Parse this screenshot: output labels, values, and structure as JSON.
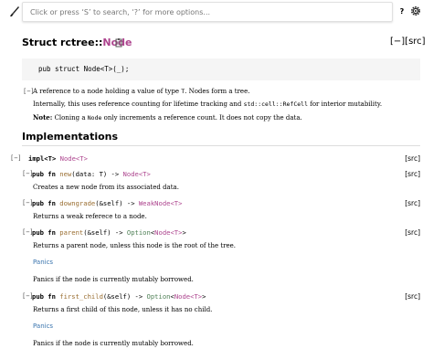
{
  "search": {
    "placeholder": "Click or press ‘S’ to search, ‘?’ for more options..."
  },
  "help_button": "?",
  "title": {
    "prefix": "Struct rctree::",
    "name": "Node"
  },
  "src_link": "[−][src]",
  "declaration": "pub struct Node<T>(_);",
  "doc_toggle": "[−]",
  "docs": {
    "line1_pre": "A reference to a node holding a value of type ",
    "line1_code": "T",
    "line1_post": ". Nodes form a tree.",
    "line2_pre": "Internally, this uses reference counting for lifetime tracking and ",
    "line2_code": "std::cell::RefCell",
    "line2_post": " for interior mutability.",
    "line3_bold": "Note:",
    "line3_pre": " Cloning a ",
    "line3_code": "Node",
    "line3_post": " only increments a reference count. It does not copy the data."
  },
  "implementations_heading": "Implementations",
  "impl": {
    "toggle": "[−]",
    "kw": "impl<T> ",
    "type": "Node<T>",
    "src": "[src]"
  },
  "methods": [
    {
      "toggle": "[−]",
      "kw": "pub fn ",
      "name": "new",
      "args": "(data: T) -> ",
      "ret_type": "Node<T>",
      "ret_tail": "",
      "src": "[src]",
      "doc": "Creates a new node from its associated data."
    },
    {
      "toggle": "[−]",
      "kw": "pub fn ",
      "name": "downgrade",
      "args": "(&self) -> ",
      "ret_type": "WeakNode<T>",
      "ret_tail": "",
      "src": "[src]",
      "doc": "Returns a weak referece to a node."
    },
    {
      "toggle": "[−]",
      "kw": "pub fn ",
      "name": "parent",
      "args": "(&self) -> ",
      "ret_enum": "Option",
      "ret_open": "<",
      "ret_type": "Node<T>",
      "ret_close": ">",
      "src": "[src]",
      "doc": "Returns a parent node, unless this node is the root of the tree.",
      "panics_heading": "Panics",
      "panics_doc": "Panics if the node is currently mutably borrowed."
    },
    {
      "toggle": "[−]",
      "kw": "pub fn ",
      "name": "first_child",
      "args": "(&self) -> ",
      "ret_enum": "Option",
      "ret_open": "<",
      "ret_type": "Node<T>",
      "ret_close": ">",
      "src": "[src]",
      "doc": "Returns a first child of this node, unless it has no child.",
      "panics_heading": "Panics",
      "panics_doc": "Panics if the node is currently mutably borrowed."
    }
  ],
  "colors": {
    "type": "#ad448e",
    "fn": "#9a6e31",
    "enum": "#508157",
    "link": "#3873ad"
  }
}
